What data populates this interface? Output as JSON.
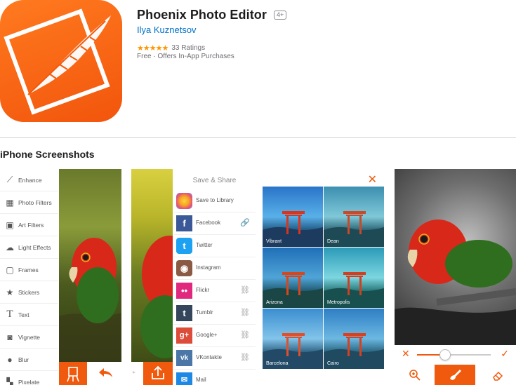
{
  "app": {
    "title": "Phoenix Photo Editor",
    "age_rating": "4+",
    "developer": "Ilya Kuznetsov",
    "stars": "★★★★★",
    "ratings_count": "33 Ratings",
    "price_info": "Free · Offers In-App Purchases",
    "accent_color": "#f05a0e"
  },
  "section": {
    "heading": "iPhone Screenshots"
  },
  "screenshot1": {
    "menu": [
      {
        "label": "Enhance",
        "icon": "magic-wand-icon"
      },
      {
        "label": "Photo Filters",
        "icon": "photo-filters-icon"
      },
      {
        "label": "Art Filters",
        "icon": "art-filters-icon"
      },
      {
        "label": "Light Effects",
        "icon": "light-effects-icon"
      },
      {
        "label": "Frames",
        "icon": "frames-icon"
      },
      {
        "label": "Stickers",
        "icon": "star-icon"
      },
      {
        "label": "Text",
        "icon": "text-icon"
      },
      {
        "label": "Vignette",
        "icon": "vignette-icon"
      },
      {
        "label": "Blur",
        "icon": "blur-icon"
      },
      {
        "label": "Pixelate",
        "icon": "pixelate-icon"
      }
    ]
  },
  "screenshot2": {
    "title": "Save & Share",
    "items": [
      {
        "label": "Save to Library",
        "icon": "photos-icon",
        "color": "#f4a623",
        "link": ""
      },
      {
        "label": "Facebook",
        "icon": "facebook-icon",
        "color": "#3b5998",
        "link": "linked"
      },
      {
        "label": "Twitter",
        "icon": "twitter-icon",
        "color": "#1da1f2",
        "link": ""
      },
      {
        "label": "Instagram",
        "icon": "instagram-icon",
        "color": "#8a5a44",
        "link": ""
      },
      {
        "label": "Flickr",
        "icon": "flickr-icon",
        "color": "#e0287e",
        "link": "unlinked"
      },
      {
        "label": "Tumblr",
        "icon": "tumblr-icon",
        "color": "#35465c",
        "link": "unlinked"
      },
      {
        "label": "Google+",
        "icon": "google-plus-icon",
        "color": "#dd4b39",
        "link": "unlinked"
      },
      {
        "label": "VKontakte",
        "icon": "vk-icon",
        "color": "#4a76a8",
        "link": "unlinked"
      },
      {
        "label": "Mail",
        "icon": "mail-icon",
        "color": "#1e88e5",
        "link": ""
      }
    ]
  },
  "screenshot3": {
    "filters": [
      "Vibrant",
      "Dean",
      "Arizona",
      "Metropolis",
      "Barcelona",
      "Cairo"
    ]
  }
}
